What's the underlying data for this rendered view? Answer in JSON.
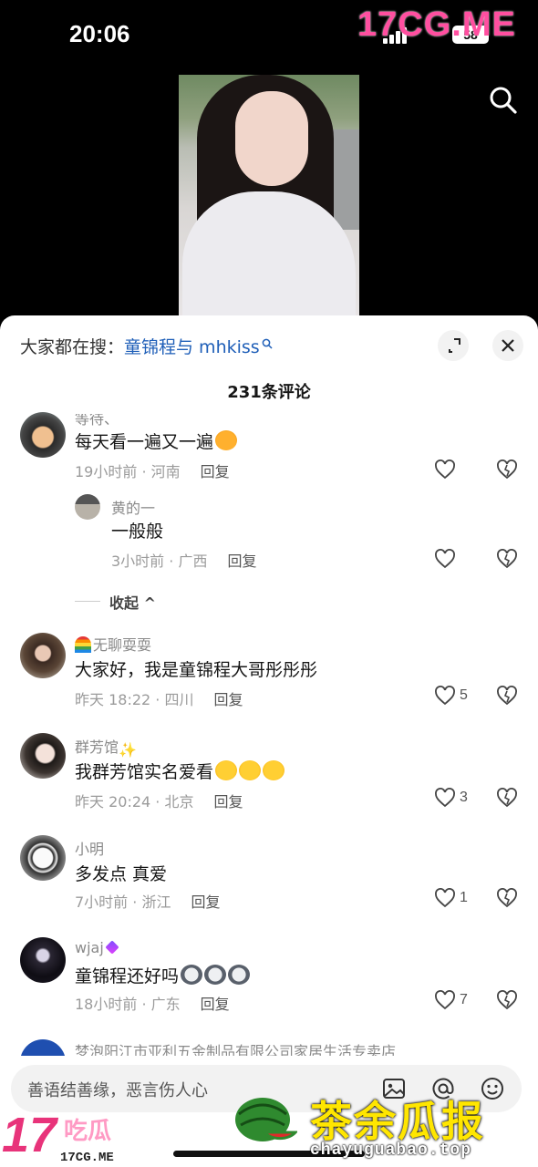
{
  "status_bar": {
    "time": "20:06",
    "battery": "58"
  },
  "watermark_top": "17CG.ME",
  "sheet": {
    "hot_search_prefix": "大家都在搜：",
    "hot_search_keyword": "童锦程与 mhkiss",
    "comment_count": "231条评论",
    "collapse_label": "收起"
  },
  "comments": [
    {
      "name": "等待、",
      "text": "每天看一遍又一遍",
      "time": "19小时前",
      "location": "河南",
      "reply_label": "回复",
      "likes": ""
    },
    {
      "name": "黄的一",
      "text": "一般般",
      "time": "3小时前",
      "location": "广西",
      "reply_label": "回复",
      "likes": ""
    },
    {
      "name": "无聊耍耍",
      "text": "大家好，我是童锦程大哥彤彤彤",
      "time": "昨天 18:22",
      "location": "四川",
      "reply_label": "回复",
      "likes": "5"
    },
    {
      "name": "群芳馆",
      "text": "我群芳馆实名爱看",
      "time": "昨天 20:24",
      "location": "北京",
      "reply_label": "回复",
      "likes": "3"
    },
    {
      "name": "小明",
      "text": "多发点  真爱",
      "time": "7小时前",
      "location": "浙江",
      "reply_label": "回复",
      "likes": "1"
    },
    {
      "name": "wjaj",
      "text": "童锦程还好吗",
      "time": "18小时前",
      "location": "广东",
      "reply_label": "回复",
      "likes": "7"
    },
    {
      "name": "梦泡阳江市亚利五金制品有限公司家居生活专卖店"
    }
  ],
  "input": {
    "placeholder": "善语结善缘，恶言伤人心"
  },
  "watermark_left": {
    "big": "17",
    "cn": "吃瓜",
    "small": "17CG.ME"
  },
  "watermark_right": {
    "cn": "茶余瓜报",
    "url": "chayuguabao.top"
  },
  "icons": {
    "search": "search-icon",
    "expand": "expand-icon",
    "close": "close-icon",
    "like": "heart-icon",
    "dislike": "broken-heart-icon",
    "image": "image-icon",
    "mention": "at-icon",
    "emoji": "emoji-icon"
  },
  "colors": {
    "keyword": "#1f5fb8",
    "watermark_pink": "#e8337a",
    "watermark_yellow": "#ffe600"
  }
}
